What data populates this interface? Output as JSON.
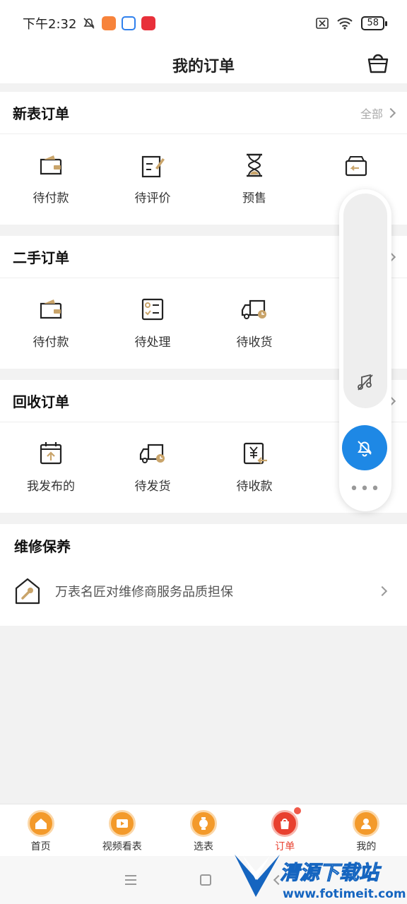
{
  "status": {
    "time": "下午2:32",
    "battery": "58"
  },
  "header": {
    "title": "我的订单"
  },
  "new_orders": {
    "title": "新表订单",
    "more": "全部",
    "items": [
      {
        "label": "待付款",
        "icon": "wallet-icon"
      },
      {
        "label": "待评价",
        "icon": "review-icon"
      },
      {
        "label": "预售",
        "icon": "hourglass-icon"
      },
      {
        "label": "",
        "icon": "return-box-icon"
      }
    ]
  },
  "used_orders": {
    "title": "二手订单",
    "items": [
      {
        "label": "待付款",
        "icon": "wallet-icon"
      },
      {
        "label": "待处理",
        "icon": "checklist-icon"
      },
      {
        "label": "待收货",
        "icon": "truck-icon"
      }
    ]
  },
  "recycle_orders": {
    "title": "回收订单",
    "items": [
      {
        "label": "我发布的",
        "icon": "calendar-upload-icon"
      },
      {
        "label": "待发货",
        "icon": "truck-icon"
      },
      {
        "label": "待收款",
        "icon": "yuan-receipt-icon"
      }
    ]
  },
  "repair": {
    "title": "维修保养",
    "text": "万表名匠对维修商服务品质担保"
  },
  "tabs": [
    {
      "label": "首页",
      "icon": "home-icon"
    },
    {
      "label": "视频看表",
      "icon": "video-icon"
    },
    {
      "label": "选表",
      "icon": "watch-icon"
    },
    {
      "label": "订单",
      "icon": "bag-icon",
      "active": true
    },
    {
      "label": "我的",
      "icon": "user-icon"
    }
  ],
  "watermark": {
    "text": "清源下载站",
    "url": "www.fotimeit.com"
  },
  "colors": {
    "accent": "#e8402f",
    "tab_orange": "#f39a2b",
    "float_blue": "#1e88e5",
    "icon_gold": "#c9a46a"
  }
}
